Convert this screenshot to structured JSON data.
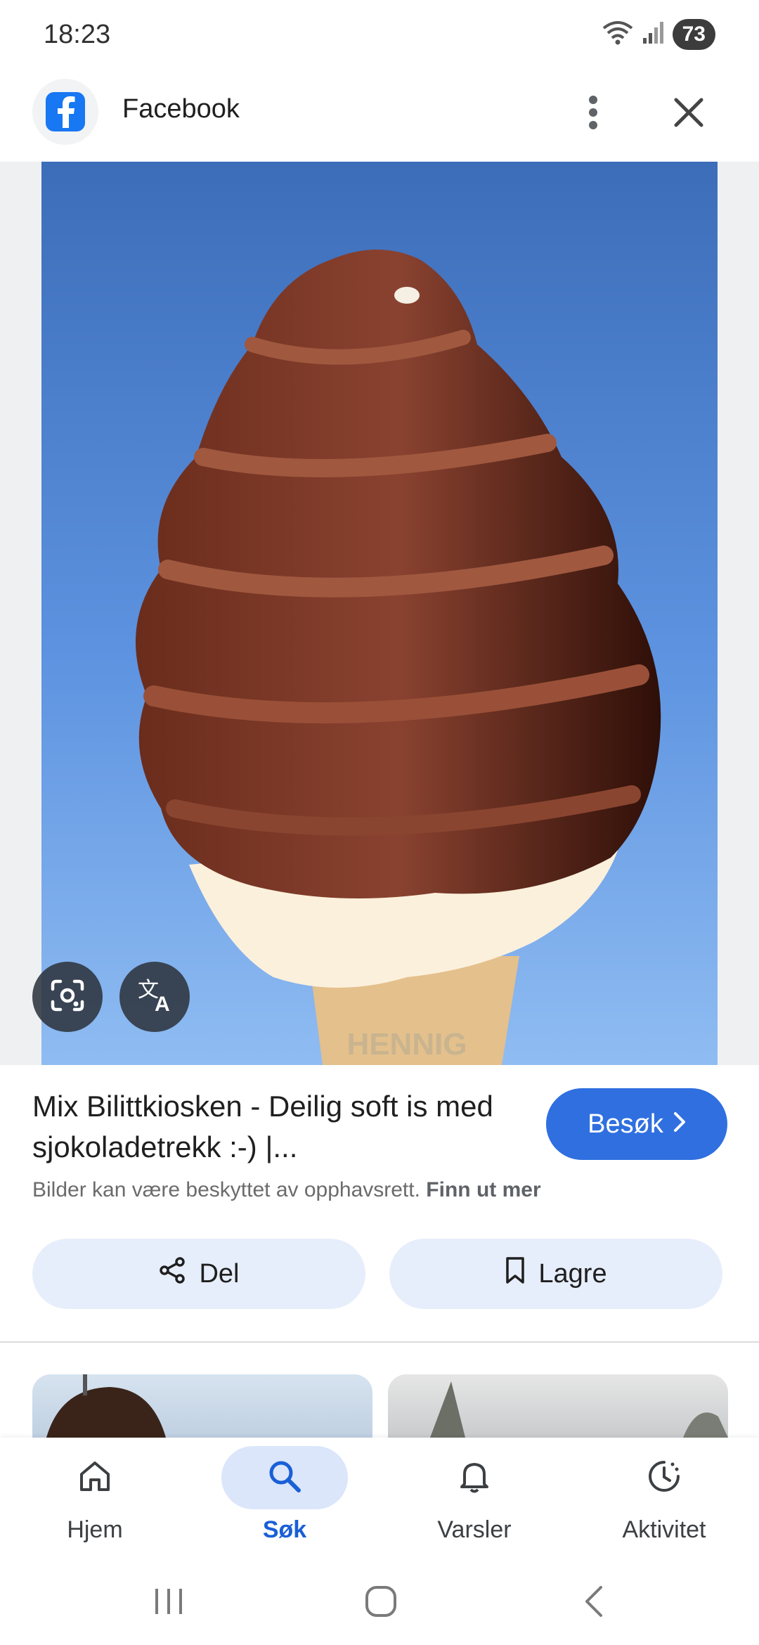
{
  "status_bar": {
    "time": "18:23",
    "battery": "73",
    "icons": [
      "wifi-icon",
      "signal-icon",
      "battery-icon"
    ]
  },
  "app_bar": {
    "source_icon": "facebook-icon",
    "title": "Facebook",
    "more_icon": "more-vert-icon",
    "close_icon": "close-icon"
  },
  "image": {
    "subject": "chocolate-dipped soft serve ice cream cone",
    "overlay_text": "HENNIG",
    "lens_icon": "lens-icon",
    "translate_icon": "translate-icon"
  },
  "result": {
    "title": "Mix Bilittkiosken - Deilig soft is med sjokoladetrekk :-) |...",
    "visit_label": "Besøk",
    "copyright_text": "Bilder kan være beskyttet av opphavsrett.",
    "learn_more": "Finn ut mer"
  },
  "actions": {
    "share_label": "Del",
    "save_label": "Lagre"
  },
  "bottom_nav": {
    "items": [
      {
        "label": "Hjem",
        "icon": "home-icon",
        "active": false
      },
      {
        "label": "Søk",
        "icon": "search-icon",
        "active": true
      },
      {
        "label": "Varsler",
        "icon": "bell-icon",
        "active": false
      },
      {
        "label": "Aktivitet",
        "icon": "activity-icon",
        "active": false
      }
    ]
  },
  "colors": {
    "accent": "#2f6fe0",
    "active_nav": "#1a5fd6",
    "chip_bg": "#e7eefb",
    "sky": "#3f74c9"
  }
}
